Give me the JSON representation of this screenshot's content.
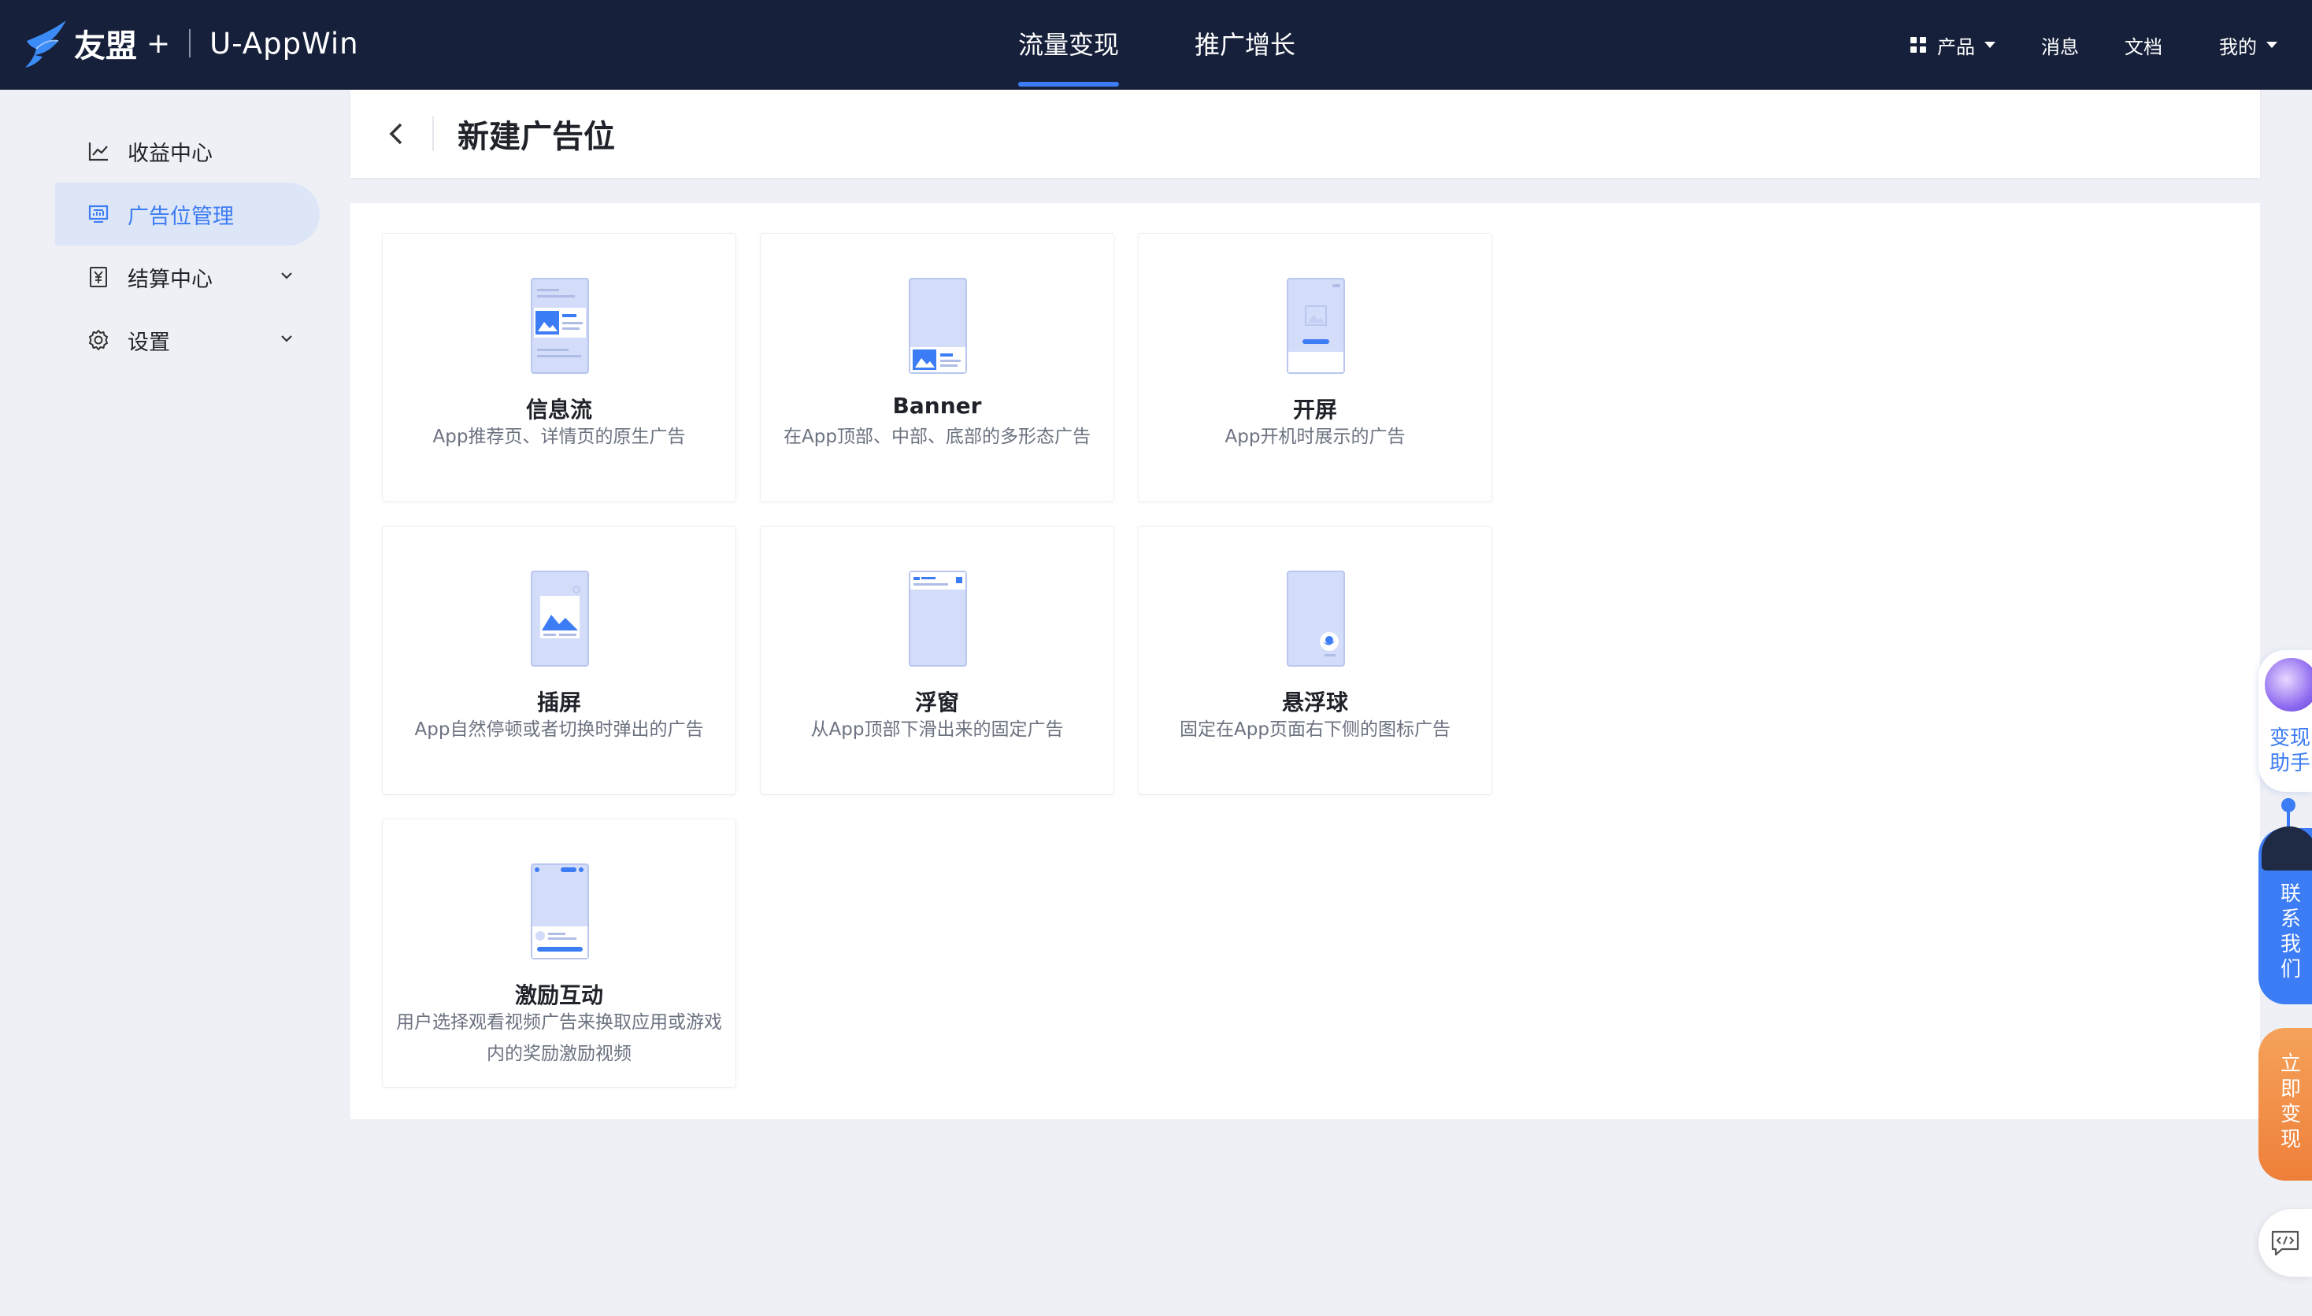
{
  "app": {
    "brand": "友盟",
    "plus": "+",
    "product": "U-AppWin"
  },
  "main_nav": [
    {
      "label": "流量变现",
      "active": true
    },
    {
      "label": "推广增长",
      "active": false
    }
  ],
  "right_nav": {
    "products": "产品",
    "messages": "消息",
    "docs": "文档",
    "mine": "我的"
  },
  "sidebar": {
    "items": [
      {
        "label": "收益中心",
        "icon": "chart-line-icon",
        "active": false
      },
      {
        "label": "广告位管理",
        "icon": "monitor-icon",
        "active": true
      },
      {
        "label": "结算中心",
        "icon": "yuan-document-icon",
        "expandable": true
      },
      {
        "label": "设置",
        "icon": "gear-icon",
        "expandable": true
      }
    ]
  },
  "header": {
    "title": "新建广告位"
  },
  "ad_types": [
    {
      "name": "信息流",
      "desc": "App推荐页、详情页的原生广告"
    },
    {
      "name": "Banner",
      "desc": "在App顶部、中部、底部的多形态广告"
    },
    {
      "name": "开屏",
      "desc": "App开机时展示的广告"
    },
    {
      "name": "插屏",
      "desc": "App自然停顿或者切换时弹出的广告"
    },
    {
      "name": "浮窗",
      "desc": "从App顶部下滑出来的固定广告"
    },
    {
      "name": "悬浮球",
      "desc": "固定在App页面右下侧的图标广告"
    },
    {
      "name": "激励互动",
      "desc": "用户选择观看视频广告来换取应用或游戏内的奖励激励视频"
    }
  ],
  "floating": {
    "assistant": "变现助手",
    "contact": "联系我们",
    "earn": "立即变现"
  },
  "colors": {
    "accent": "#3c7cf4",
    "nav_bg": "#16203a",
    "orange": "#ee7f3a"
  }
}
